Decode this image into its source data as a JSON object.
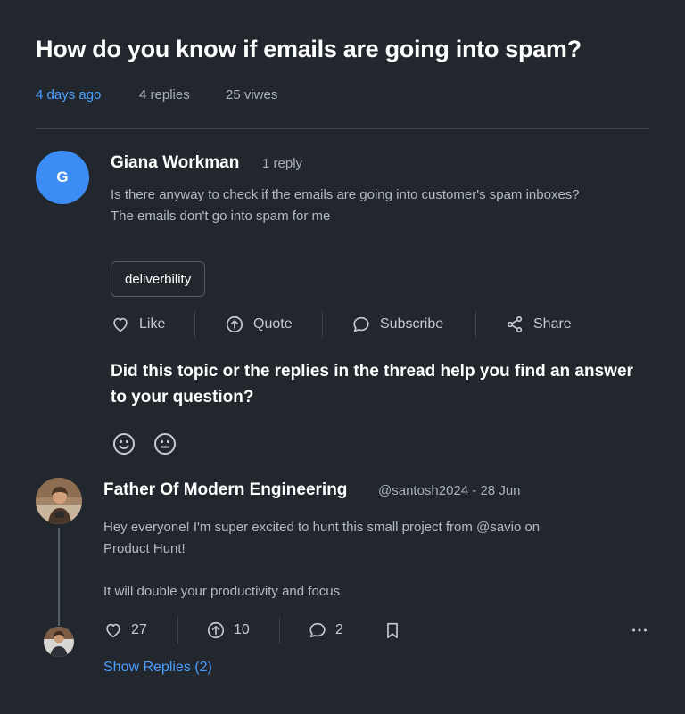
{
  "topic": {
    "title": "How do you know if emails are going into spam?",
    "time_ago": "4 days ago",
    "replies": "4 replies",
    "views": "25 viwes"
  },
  "post": {
    "avatar_initial": "G",
    "author": "Giana Workman",
    "reply_count": "1 reply",
    "body_lines": [
      "Is there anyway to check if the emails are going into customer's spam inboxes?",
      "The emails don't go into spam for me"
    ],
    "tag": "deliverbility",
    "actions": {
      "like": "Like",
      "quote": "Quote",
      "subscribe": "Subscribe",
      "share": "Share"
    }
  },
  "feedback": {
    "question": "Did this topic or the replies in the thread help you find an answer to your question?",
    "icons": [
      "smile-icon",
      "neutral-face-icon"
    ]
  },
  "reply": {
    "author": "Father Of Modern Engineering",
    "handle_date": "@santosh2024 - 28 Jun",
    "body_lines": [
      "Hey everyone! I'm super excited to hunt this small project from @savio on",
      "Product Hunt!",
      "",
      "It will double your productivity and focus."
    ],
    "likes": "27",
    "upvotes": "10",
    "comments": "2",
    "show_replies": "Show Replies (2)"
  },
  "colors": {
    "background": "#22272e",
    "accent": "#4a9eff",
    "avatar": "#3b8df5"
  }
}
